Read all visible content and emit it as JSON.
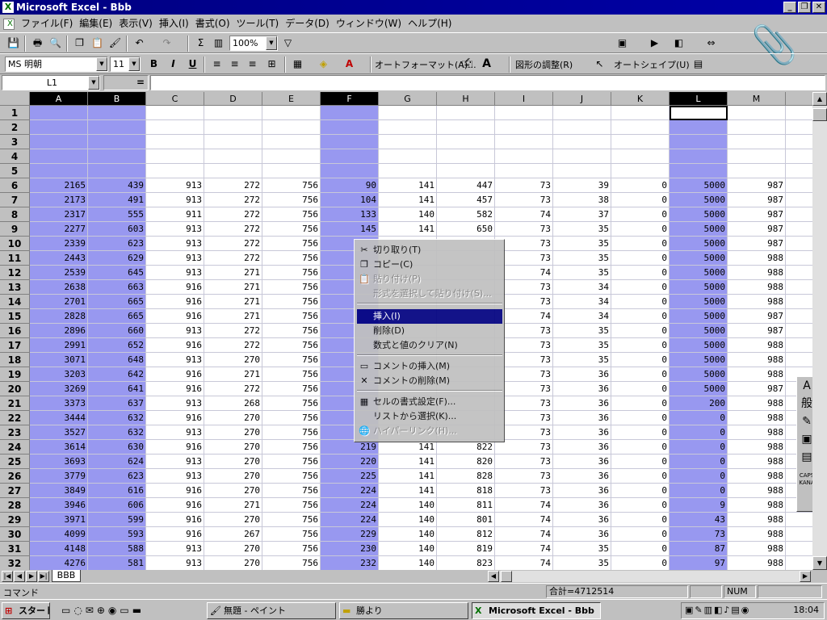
{
  "window": {
    "title": "Microsoft Excel - Bbb",
    "buttons": [
      "_",
      "❐",
      "✕"
    ]
  },
  "menu": [
    "ファイル(F)",
    "編集(E)",
    "表示(V)",
    "挿入(I)",
    "書式(O)",
    "ツール(T)",
    "データ(D)",
    "ウィンドウ(W)",
    "ヘルプ(H)"
  ],
  "toolbar": {
    "zoom": "100%",
    "font_name": "MS 明朝",
    "font_size": "11",
    "autoformat": "オートフォーマット(A)...",
    "picture_adjust": "図形の調整(R)",
    "autoshape": "オートシェイプ(U)"
  },
  "formula_bar": {
    "name_box": "L1",
    "equals": "="
  },
  "columns": [
    "A",
    "B",
    "C",
    "D",
    "E",
    "F",
    "G",
    "H",
    "I",
    "J",
    "K",
    "L",
    "M"
  ],
  "selected_columns": [
    "A",
    "B",
    "F",
    "L"
  ],
  "rows": [
    {
      "n": "1",
      "v": [
        "",
        "",
        "",
        "",
        "",
        "",
        "",
        "",
        "",
        "",
        "",
        "",
        ""
      ]
    },
    {
      "n": "2",
      "v": [
        "",
        "",
        "",
        "",
        "",
        "",
        "",
        "",
        "",
        "",
        "",
        "",
        ""
      ]
    },
    {
      "n": "3",
      "v": [
        "",
        "",
        "",
        "",
        "",
        "",
        "",
        "",
        "",
        "",
        "",
        "",
        ""
      ]
    },
    {
      "n": "4",
      "v": [
        "",
        "",
        "",
        "",
        "",
        "",
        "",
        "",
        "",
        "",
        "",
        "",
        ""
      ]
    },
    {
      "n": "5",
      "v": [
        "",
        "",
        "",
        "",
        "",
        "",
        "",
        "",
        "",
        "",
        "",
        "",
        ""
      ]
    },
    {
      "n": "6",
      "v": [
        "2165",
        "439",
        "913",
        "272",
        "756",
        "90",
        "141",
        "447",
        "73",
        "39",
        "0",
        "5000",
        "987"
      ]
    },
    {
      "n": "7",
      "v": [
        "2173",
        "491",
        "913",
        "272",
        "756",
        "104",
        "141",
        "457",
        "73",
        "38",
        "0",
        "5000",
        "987"
      ]
    },
    {
      "n": "8",
      "v": [
        "2317",
        "555",
        "911",
        "272",
        "756",
        "133",
        "140",
        "582",
        "74",
        "37",
        "0",
        "5000",
        "987"
      ]
    },
    {
      "n": "9",
      "v": [
        "2277",
        "603",
        "913",
        "272",
        "756",
        "145",
        "141",
        "650",
        "73",
        "35",
        "0",
        "5000",
        "987"
      ]
    },
    {
      "n": "10",
      "v": [
        "2339",
        "623",
        "913",
        "272",
        "756",
        "",
        "",
        "",
        "73",
        "35",
        "0",
        "5000",
        "987"
      ]
    },
    {
      "n": "11",
      "v": [
        "2443",
        "629",
        "913",
        "272",
        "756",
        "",
        "",
        "",
        "73",
        "35",
        "0",
        "5000",
        "988"
      ]
    },
    {
      "n": "12",
      "v": [
        "2539",
        "645",
        "913",
        "271",
        "756",
        "",
        "",
        "",
        "74",
        "35",
        "0",
        "5000",
        "988"
      ]
    },
    {
      "n": "13",
      "v": [
        "2638",
        "663",
        "916",
        "271",
        "756",
        "",
        "",
        "",
        "73",
        "34",
        "0",
        "5000",
        "988"
      ]
    },
    {
      "n": "14",
      "v": [
        "2701",
        "665",
        "916",
        "271",
        "756",
        "",
        "",
        "",
        "73",
        "34",
        "0",
        "5000",
        "988"
      ]
    },
    {
      "n": "15",
      "v": [
        "2828",
        "665",
        "916",
        "271",
        "756",
        "",
        "",
        "",
        "74",
        "34",
        "0",
        "5000",
        "987"
      ]
    },
    {
      "n": "16",
      "v": [
        "2896",
        "660",
        "913",
        "272",
        "756",
        "",
        "",
        "",
        "73",
        "35",
        "0",
        "5000",
        "987"
      ]
    },
    {
      "n": "17",
      "v": [
        "2991",
        "652",
        "916",
        "272",
        "756",
        "",
        "",
        "",
        "73",
        "35",
        "0",
        "5000",
        "988"
      ]
    },
    {
      "n": "18",
      "v": [
        "3071",
        "648",
        "913",
        "270",
        "756",
        "",
        "",
        "",
        "73",
        "35",
        "0",
        "5000",
        "988"
      ]
    },
    {
      "n": "19",
      "v": [
        "3203",
        "642",
        "916",
        "271",
        "756",
        "",
        "",
        "",
        "73",
        "36",
        "0",
        "5000",
        "988"
      ]
    },
    {
      "n": "20",
      "v": [
        "3269",
        "641",
        "916",
        "272",
        "756",
        "",
        "",
        "",
        "73",
        "36",
        "0",
        "5000",
        "987"
      ]
    },
    {
      "n": "21",
      "v": [
        "3373",
        "637",
        "913",
        "268",
        "756",
        "",
        "",
        "",
        "73",
        "36",
        "0",
        "200",
        "988"
      ]
    },
    {
      "n": "22",
      "v": [
        "3444",
        "632",
        "916",
        "270",
        "756",
        "",
        "",
        "",
        "73",
        "36",
        "0",
        "0",
        "988"
      ]
    },
    {
      "n": "23",
      "v": [
        "3527",
        "632",
        "913",
        "270",
        "756",
        "",
        "",
        "",
        "73",
        "36",
        "0",
        "0",
        "988"
      ]
    },
    {
      "n": "24",
      "v": [
        "3614",
        "630",
        "916",
        "270",
        "756",
        "219",
        "141",
        "822",
        "73",
        "36",
        "0",
        "0",
        "988"
      ]
    },
    {
      "n": "25",
      "v": [
        "3693",
        "624",
        "913",
        "270",
        "756",
        "220",
        "141",
        "820",
        "73",
        "36",
        "0",
        "0",
        "988"
      ]
    },
    {
      "n": "26",
      "v": [
        "3779",
        "623",
        "913",
        "270",
        "756",
        "225",
        "141",
        "828",
        "73",
        "36",
        "0",
        "0",
        "988"
      ]
    },
    {
      "n": "27",
      "v": [
        "3849",
        "616",
        "916",
        "270",
        "756",
        "224",
        "141",
        "818",
        "73",
        "36",
        "0",
        "0",
        "988"
      ]
    },
    {
      "n": "28",
      "v": [
        "3946",
        "606",
        "916",
        "271",
        "756",
        "224",
        "140",
        "811",
        "74",
        "36",
        "0",
        "9",
        "988"
      ]
    },
    {
      "n": "29",
      "v": [
        "3971",
        "599",
        "916",
        "270",
        "756",
        "224",
        "140",
        "801",
        "74",
        "36",
        "0",
        "43",
        "988"
      ]
    },
    {
      "n": "30",
      "v": [
        "4099",
        "593",
        "916",
        "267",
        "756",
        "229",
        "140",
        "812",
        "74",
        "36",
        "0",
        "73",
        "988"
      ]
    },
    {
      "n": "31",
      "v": [
        "4148",
        "588",
        "913",
        "270",
        "756",
        "230",
        "140",
        "819",
        "74",
        "35",
        "0",
        "87",
        "988"
      ]
    },
    {
      "n": "32",
      "v": [
        "4276",
        "581",
        "913",
        "270",
        "756",
        "232",
        "140",
        "823",
        "74",
        "35",
        "0",
        "97",
        "988"
      ]
    }
  ],
  "context_menu": {
    "items": [
      {
        "label": "切り取り(T)",
        "icon": "✂",
        "state": "normal"
      },
      {
        "label": "コピー(C)",
        "icon": "❐",
        "state": "normal"
      },
      {
        "label": "貼り付け(P)",
        "icon": "📋",
        "state": "disabled"
      },
      {
        "label": "形式を選択して貼り付け(S)...",
        "icon": "",
        "state": "disabled"
      },
      {
        "label": "挿入(I)",
        "icon": "",
        "state": "highlighted"
      },
      {
        "label": "削除(D)",
        "icon": "",
        "state": "normal"
      },
      {
        "label": "数式と値のクリア(N)",
        "icon": "",
        "state": "normal"
      },
      {
        "label": "コメントの挿入(M)",
        "icon": "▭",
        "state": "normal"
      },
      {
        "label": "コメントの削除(M)",
        "icon": "✕",
        "state": "normal"
      },
      {
        "label": "セルの書式設定(F)...",
        "icon": "▦",
        "state": "normal"
      },
      {
        "label": "リストから選択(K)...",
        "icon": "",
        "state": "normal"
      },
      {
        "label": "ハイパーリンク(H)...",
        "icon": "🌐",
        "state": "disabled"
      }
    ]
  },
  "sheet_tab": "BBB",
  "status": {
    "mode": "コマンド",
    "sum": "合計=4712514",
    "num": "NUM"
  },
  "ime_bar": [
    "A",
    "般",
    "✎",
    "▣",
    "▤",
    "CAPS KANA"
  ],
  "taskbar": {
    "start": "スタート",
    "buttons": [
      {
        "label": "無題 - ペイント",
        "active": false
      },
      {
        "label": "勝より",
        "active": false
      },
      {
        "label": "Microsoft Excel - Bbb",
        "active": true
      }
    ],
    "clock": "18:04"
  },
  "colors": {
    "title_bar": "#000080",
    "selection": "#9898f0",
    "highlight": "#000080"
  }
}
